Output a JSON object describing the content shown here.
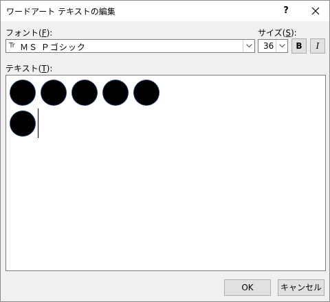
{
  "window": {
    "title": "ワードアート テキストの編集",
    "help": "?"
  },
  "font": {
    "label_prefix": "フォント(",
    "label_key": "F",
    "label_suffix": "):",
    "type_icon": "Tr",
    "value": "ＭＳ Ｐゴシック"
  },
  "size": {
    "label_prefix": "サイズ(",
    "label_key": "S",
    "label_suffix": "):",
    "value": "36"
  },
  "format": {
    "bold": "B",
    "italic": "I"
  },
  "text": {
    "label_prefix": "テキスト(",
    "label_key": "T",
    "label_suffix": "):",
    "content": "●●●●●\n●"
  },
  "buttons": {
    "ok": "OK",
    "cancel": "キャンセル"
  }
}
